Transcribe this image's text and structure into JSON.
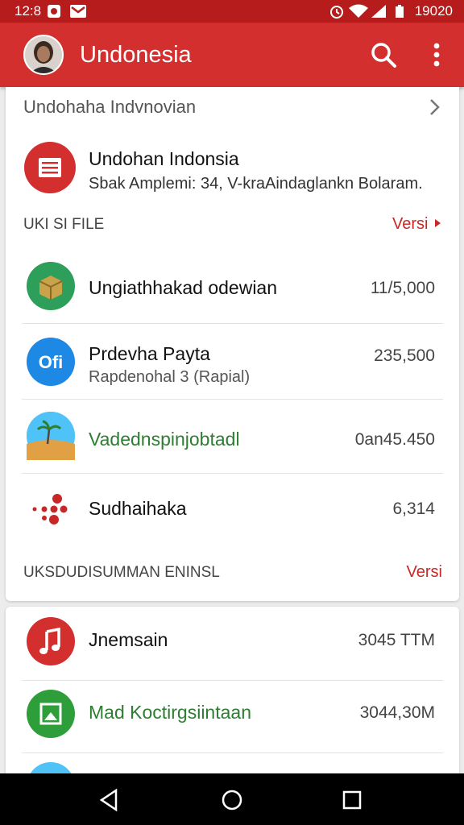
{
  "status_bar": {
    "time": "12:8",
    "right_time": "19020"
  },
  "app_bar": {
    "title": "Undonesia"
  },
  "breadcrumb": {
    "label": "Undohaha Indvnovian"
  },
  "featured": {
    "title": "Undohan Indonsia",
    "subtitle": "Sbak Amplemi: 34, V-kraAindaglankn Bolaram."
  },
  "section1": {
    "label": "UKI SI FILE",
    "link": "Versi"
  },
  "items1": [
    {
      "title": "Ungiathhakad odewian",
      "value": "11/5,000",
      "title_color": "#111111"
    },
    {
      "title": "Prdevha Payta",
      "subtitle": "Rapdenohal 3 (Rapial)",
      "value": "235,500",
      "title_color": "#111111"
    },
    {
      "title": "Vadednspinjobtadl",
      "value": "0an45.450",
      "title_color": "#2e7d32"
    },
    {
      "title": "Sudhaihaka",
      "value": "6,314",
      "title_color": "#111111"
    }
  ],
  "section2": {
    "label": "UKSDUDISUMMAN ENINSL",
    "link": "Versi"
  },
  "items2": [
    {
      "title": "Jnemsain",
      "value": "3045 TTM",
      "title_color": "#111111"
    },
    {
      "title": "Mad Koctirgsiintaan",
      "value": "3044,30M",
      "title_color": "#2e7d32"
    }
  ],
  "colors": {
    "appbar": "#d32f2f",
    "statusbar": "#b71c1c",
    "accent": "#c62828"
  }
}
